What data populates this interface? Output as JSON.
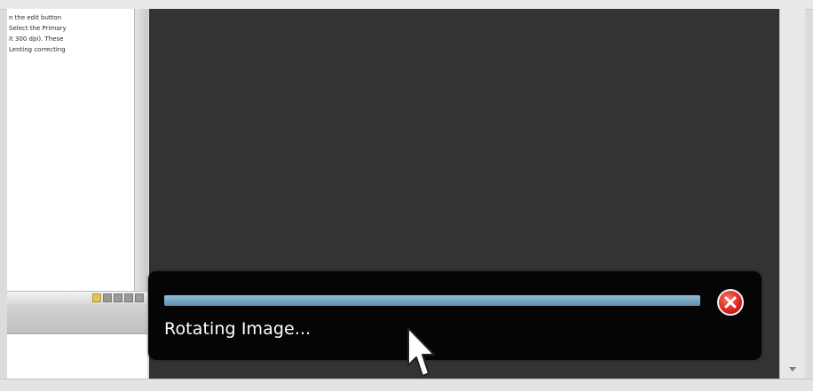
{
  "document": {
    "lines": [
      "n the edit button",
      "Select the Primary",
      "it 300 dpi). These",
      "Lenting correcting"
    ]
  },
  "progress": {
    "label": "Rotating Image...",
    "percent": 100
  },
  "icons": {
    "cancel": "cancel-x-icon",
    "cursor": "mouse-pointer-icon",
    "scroll_down": "chevron-down-icon"
  },
  "colors": {
    "viewer_bg": "#333333",
    "panel_bg": "#050505",
    "progress_fill": "#7aa7c7",
    "cancel_red": "#d8201a"
  }
}
